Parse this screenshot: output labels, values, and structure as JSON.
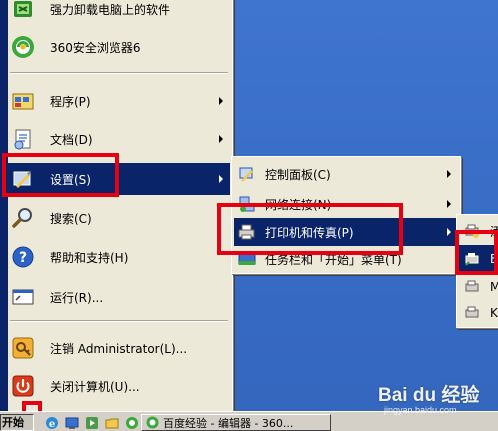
{
  "start_menu": {
    "pinned": [
      {
        "label": "强力卸载电脑上的软件",
        "icon": "uninstaller-icon"
      },
      {
        "label": "360安全浏览器6",
        "icon": "360-browser-icon"
      }
    ],
    "items": [
      {
        "label": "程序(P)",
        "icon": "programs-icon"
      },
      {
        "label": "文档(D)",
        "icon": "documents-icon"
      },
      {
        "label": "设置(S)",
        "icon": "settings-icon"
      },
      {
        "label": "搜索(C)",
        "icon": "search-icon"
      },
      {
        "label": "帮助和支持(H)",
        "icon": "help-icon"
      },
      {
        "label": "运行(R)...",
        "icon": "run-icon"
      },
      {
        "label": "注销 Administrator(L)...",
        "icon": "logoff-icon"
      },
      {
        "label": "关闭计算机(U)...",
        "icon": "shutdown-icon"
      }
    ]
  },
  "settings_submenu": {
    "items": [
      {
        "label": "控制面板(C)",
        "icon": "control-panel-icon"
      },
      {
        "label": "网络连接(N)",
        "icon": "network-connections-icon"
      },
      {
        "label": "打印机和传真(P)",
        "icon": "printer-fax-icon"
      },
      {
        "label": "任务栏和「开始」菜单(T)",
        "icon": "taskbar-icon"
      }
    ]
  },
  "printers_submenu": {
    "items": [
      {
        "label": "添",
        "icon": "add-printer-icon"
      },
      {
        "label": "E",
        "icon": "printer-icon"
      },
      {
        "label": "M",
        "icon": "printer-icon"
      },
      {
        "label": "K",
        "icon": "printer-icon"
      }
    ]
  },
  "taskbar": {
    "start_label": "开始",
    "task_label": "百度经验 - 编辑器 - 360..."
  },
  "watermark": {
    "brand": "Bai du 经验",
    "url": "jingyan.baidu.com"
  },
  "colors": {
    "menu_bg": "#ece9d8",
    "highlight": "#0a246a",
    "desktop": "#3b6fc8",
    "red_frame": "#e60012"
  }
}
